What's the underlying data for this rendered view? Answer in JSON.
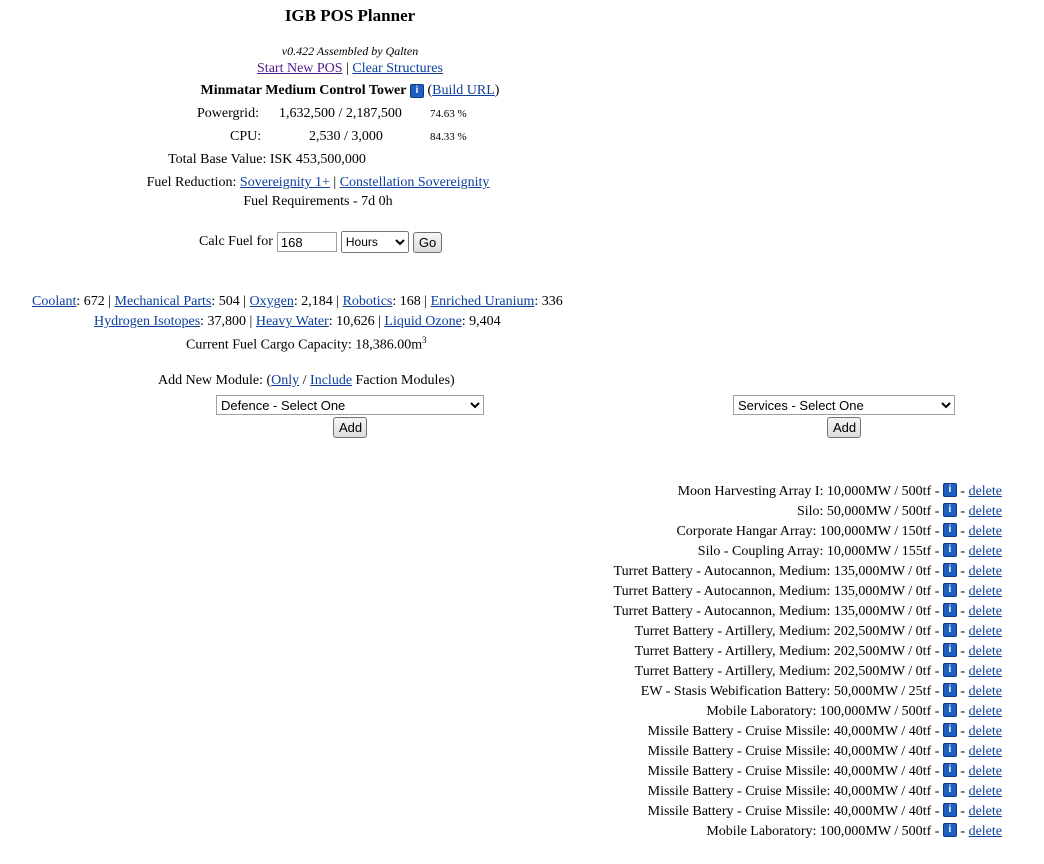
{
  "header": {
    "title": "IGB POS Planner",
    "version": "v0.422 Assembled by Qalten",
    "start_new": "Start New POS",
    "separator": "|",
    "clear": "Clear Structures"
  },
  "tower": {
    "name": "Minmatar Medium Control Tower",
    "info_icon": "info-icon",
    "build_url": "Build URL",
    "paren_open": "(",
    "paren_close": ")"
  },
  "stats": {
    "powergrid": {
      "label": "Powergrid:",
      "value": "1,632,500  / 2,187,500",
      "pct": "74.63 %"
    },
    "cpu": {
      "label": "CPU:",
      "value": "2,530 / 3,000",
      "pct": "84.33 %"
    },
    "total_base": "Total Base Value: ISK 453,500,000",
    "fuel_reduction_label": "Fuel Reduction:",
    "sov1": "Sovereignity 1+",
    "const_sov": "Constellation Sovereignity",
    "fuel_requirements": "Fuel Requirements - 7d 0h"
  },
  "calc": {
    "label": "Calc Fuel for",
    "value": "168",
    "unit": "Hours",
    "go": "Go"
  },
  "fuel": {
    "coolant": {
      "label": "Coolant",
      "value": ": 672 | "
    },
    "mech": {
      "label": "Mechanical Parts",
      "value": ": 504 | "
    },
    "oxygen": {
      "label": "Oxygen",
      "value": ": 2,184 | "
    },
    "robotics": {
      "label": "Robotics",
      "value": ": 168 | "
    },
    "uranium": {
      "label": "Enriched Uranium",
      "value": ": 336"
    },
    "hydrogen": {
      "label": "Hydrogen Isotopes",
      "value": ": 37,800 | "
    },
    "heavy": {
      "label": "Heavy Water",
      "value": ": 10,626 | "
    },
    "ozone": {
      "label": "Liquid Ozone",
      "value": ": 9,404"
    },
    "cargo": "Current Fuel Cargo Capacity: 18,386.00m",
    "cargo_sup": "3"
  },
  "add_module": {
    "prefix": "Add New Module: (",
    "only": "Only",
    "slash": " / ",
    "include": "Include",
    "suffix": " Faction Modules)",
    "defence_select": "Defence - Select One",
    "services_select": "Services - Select One",
    "add_label": "Add"
  },
  "modules": [
    {
      "text": "Moon Harvesting Array I: 10,000MW / 500tf -"
    },
    {
      "text": "Silo: 50,000MW / 500tf -"
    },
    {
      "text": "Corporate Hangar Array: 100,000MW / 150tf -"
    },
    {
      "text": "Silo - Coupling Array: 10,000MW / 155tf -"
    },
    {
      "text": "Turret Battery - Autocannon, Medium: 135,000MW / 0tf -"
    },
    {
      "text": "Turret Battery - Autocannon, Medium: 135,000MW / 0tf -"
    },
    {
      "text": "Turret Battery - Autocannon, Medium: 135,000MW / 0tf -"
    },
    {
      "text": "Turret Battery - Artillery, Medium: 202,500MW / 0tf -"
    },
    {
      "text": "Turret Battery - Artillery, Medium: 202,500MW / 0tf -"
    },
    {
      "text": "Turret Battery - Artillery, Medium: 202,500MW / 0tf -"
    },
    {
      "text": "EW - Stasis Webification Battery: 50,000MW / 25tf -"
    },
    {
      "text": "Mobile Laboratory: 100,000MW / 500tf -"
    },
    {
      "text": "Missile Battery - Cruise Missile: 40,000MW / 40tf -"
    },
    {
      "text": "Missile Battery - Cruise Missile: 40,000MW / 40tf -"
    },
    {
      "text": "Missile Battery - Cruise Missile: 40,000MW / 40tf -"
    },
    {
      "text": "Missile Battery - Cruise Missile: 40,000MW / 40tf -"
    },
    {
      "text": "Missile Battery - Cruise Missile: 40,000MW / 40tf -"
    },
    {
      "text": "Mobile Laboratory: 100,000MW / 500tf -"
    }
  ],
  "module_action": {
    "dash": " - ",
    "delete": "delete"
  },
  "colors": {
    "link": "#0b3f9c",
    "visited": "#551a8b",
    "info_icon": "#1f5fbf"
  }
}
